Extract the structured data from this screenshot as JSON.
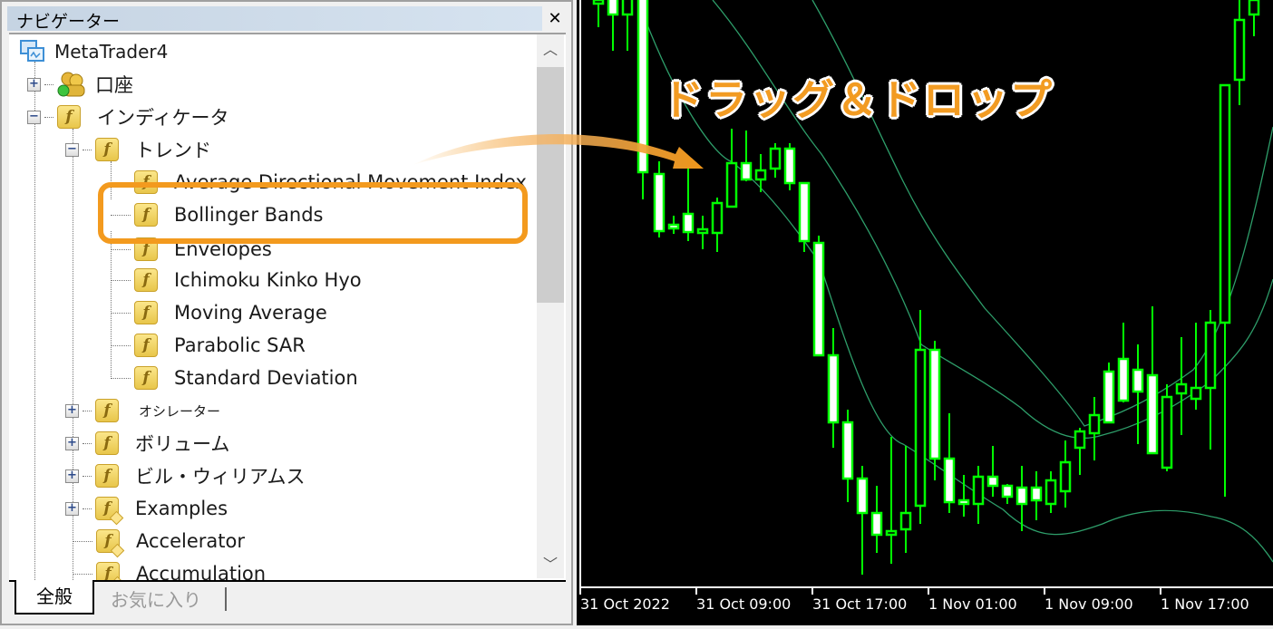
{
  "navigator": {
    "title": "ナビゲーター",
    "close_icon": "close-icon",
    "tree": [
      {
        "label": "MetaTrader4",
        "icon": "terminal-icon",
        "level": 0
      },
      {
        "label": "口座",
        "icon": "accounts-icon",
        "level": 1,
        "expander": "+"
      },
      {
        "label": "インディケータ",
        "icon": "indicator-icon",
        "level": 1,
        "expander": "−"
      },
      {
        "label": "トレンド",
        "icon": "indicator-icon",
        "level": 2,
        "expander": "−"
      },
      {
        "label": "Average Directional Movement Index",
        "icon": "indicator-icon",
        "level": 3
      },
      {
        "label": "Bollinger Bands",
        "icon": "indicator-icon",
        "level": 3,
        "highlighted": true
      },
      {
        "label": "Envelopes",
        "icon": "indicator-icon",
        "level": 3
      },
      {
        "label": "Ichimoku Kinko Hyo",
        "icon": "indicator-icon",
        "level": 3
      },
      {
        "label": "Moving Average",
        "icon": "indicator-icon",
        "level": 3
      },
      {
        "label": "Parabolic SAR",
        "icon": "indicator-icon",
        "level": 3
      },
      {
        "label": "Standard Deviation",
        "icon": "indicator-icon",
        "level": 3
      },
      {
        "label": "オシレーター",
        "icon": "indicator-icon",
        "level": 2,
        "expander": "+"
      },
      {
        "label": "ボリューム",
        "icon": "indicator-icon",
        "level": 2,
        "expander": "+"
      },
      {
        "label": "ビル・ウィリアムス",
        "icon": "indicator-icon",
        "level": 2,
        "expander": "+"
      },
      {
        "label": "Examples",
        "icon": "custom-indicator-icon",
        "level": 2,
        "expander": "+"
      },
      {
        "label": "Accelerator",
        "icon": "custom-indicator-icon",
        "level": 2
      },
      {
        "label": "Accumulation",
        "icon": "custom-indicator-icon",
        "level": 2
      }
    ],
    "tabs": [
      {
        "label": "全般",
        "active": true
      },
      {
        "label": "お気に入り",
        "active": false
      }
    ]
  },
  "chart": {
    "annotation": "ドラッグ＆ドロップ",
    "accent_color": "#f39a1e",
    "candle_color": "#00ff00",
    "band_color": "#2e9e6a",
    "x_axis_labels": [
      "31 Oct 2022",
      "31 Oct 09:00",
      "31 Oct 17:00",
      "1 Nov 01:00",
      "1 Nov 09:00",
      "1 Nov 17:00"
    ]
  }
}
